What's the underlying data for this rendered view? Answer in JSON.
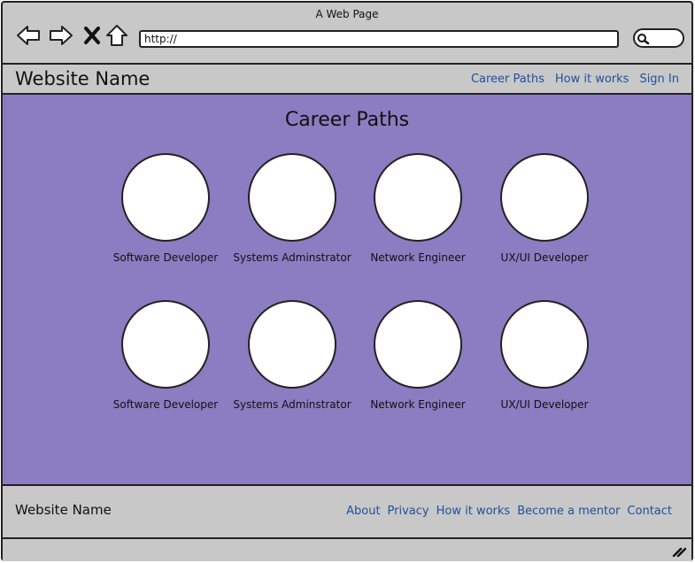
{
  "browser": {
    "title": "A Web Page",
    "address": "http://",
    "icons": [
      "back-arrow-icon",
      "forward-arrow-icon",
      "stop-x-icon",
      "home-icon",
      "search-icon"
    ]
  },
  "header": {
    "brand": "Website Name",
    "nav": [
      "Career Paths",
      "How it works",
      "Sign In"
    ]
  },
  "main": {
    "title": "Career Paths",
    "rows": [
      [
        "Software Developer",
        "Systems Adminstrator",
        "Network Engineer",
        "UX/UI Developer"
      ],
      [
        "Software Developer",
        "Systems Adminstrator",
        "Network Engineer",
        "UX/UI Developer"
      ]
    ]
  },
  "footer": {
    "brand": "Website Name",
    "links": [
      "About",
      "Privacy",
      "How it works",
      "Become a mentor",
      "Contact"
    ]
  },
  "colors": {
    "chrome": "#c8c8c8",
    "content": "#8c7cc1",
    "link": "#1f4f9e"
  }
}
